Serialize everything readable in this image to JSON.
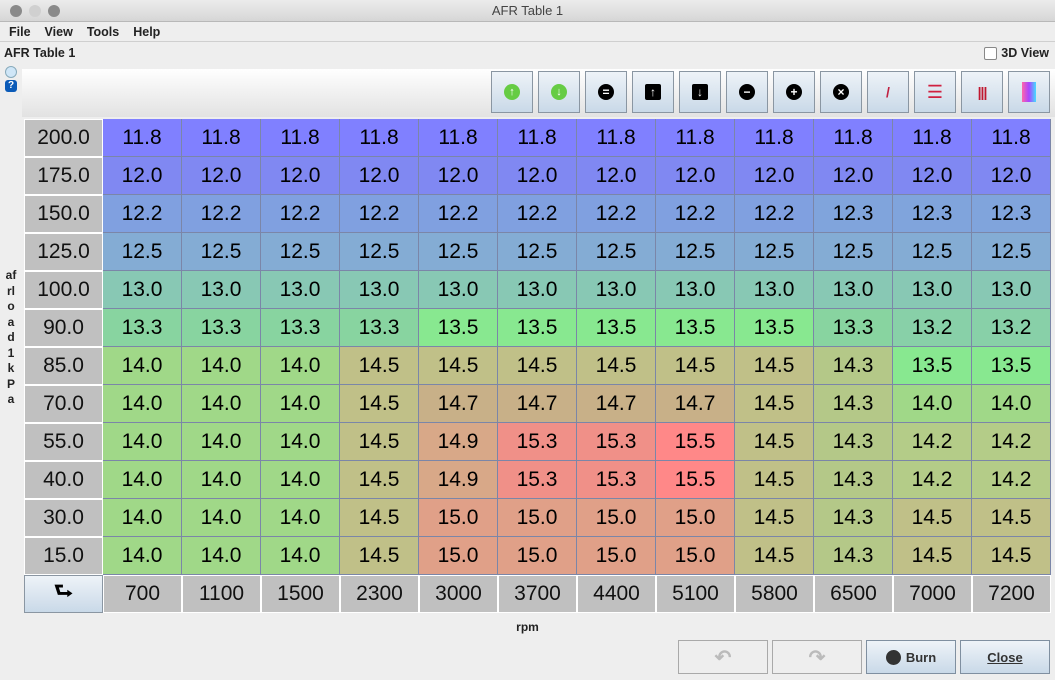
{
  "window": {
    "title": "AFR Table 1"
  },
  "menu": [
    {
      "label": "File"
    },
    {
      "label": "View"
    },
    {
      "label": "Tools"
    },
    {
      "label": "Help"
    }
  ],
  "heading": "AFR Table 1",
  "view3d_label": "3D View",
  "view3d_checked": false,
  "toolbar": [
    {
      "name": "increment-button",
      "icon": "green-up-circle",
      "glyph": "↑",
      "style": "g"
    },
    {
      "name": "decrement-button",
      "icon": "green-down-circle",
      "glyph": "↓",
      "style": "g"
    },
    {
      "name": "set-equal-button",
      "icon": "equals-circle",
      "glyph": "=",
      "style": "c"
    },
    {
      "name": "shift-up-button",
      "icon": "arrow-up-square",
      "glyph": "↑",
      "style": "sq"
    },
    {
      "name": "shift-down-button",
      "icon": "arrow-down-square",
      "glyph": "↓",
      "style": "sq"
    },
    {
      "name": "subtract-button",
      "icon": "minus-circle",
      "glyph": "−",
      "style": "c"
    },
    {
      "name": "add-button",
      "icon": "plus-circle",
      "glyph": "+",
      "style": "c"
    },
    {
      "name": "multiply-button",
      "icon": "x-circle",
      "glyph": "×",
      "style": "c"
    },
    {
      "name": "interpolate-button",
      "icon": "pencil-line",
      "glyph": "/",
      "style": "p"
    },
    {
      "name": "interpolate-horizontal-button",
      "icon": "horizontal-bars",
      "glyph": "☰",
      "style": "h"
    },
    {
      "name": "interpolate-vertical-button",
      "icon": "vertical-bars",
      "glyph": "|||",
      "style": "v"
    },
    {
      "name": "smooth-button",
      "icon": "gradient",
      "glyph": "▮",
      "style": "s"
    }
  ],
  "y_axis": {
    "label": "afrload1 kPa",
    "values": [
      "200.0",
      "175.0",
      "150.0",
      "125.0",
      "100.0",
      "90.0",
      "85.0",
      "70.0",
      "55.0",
      "40.0",
      "30.0",
      "15.0"
    ]
  },
  "x_axis": {
    "label": "rpm",
    "values": [
      "700",
      "1100",
      "1500",
      "2300",
      "3000",
      "3700",
      "4400",
      "5100",
      "5800",
      "6500",
      "7000",
      "7200"
    ]
  },
  "table": [
    [
      "11.8",
      "11.8",
      "11.8",
      "11.8",
      "11.8",
      "11.8",
      "11.8",
      "11.8",
      "11.8",
      "11.8",
      "11.8",
      "11.8"
    ],
    [
      "12.0",
      "12.0",
      "12.0",
      "12.0",
      "12.0",
      "12.0",
      "12.0",
      "12.0",
      "12.0",
      "12.0",
      "12.0",
      "12.0"
    ],
    [
      "12.2",
      "12.2",
      "12.2",
      "12.2",
      "12.2",
      "12.2",
      "12.2",
      "12.2",
      "12.2",
      "12.3",
      "12.3",
      "12.3"
    ],
    [
      "12.5",
      "12.5",
      "12.5",
      "12.5",
      "12.5",
      "12.5",
      "12.5",
      "12.5",
      "12.5",
      "12.5",
      "12.5",
      "12.5"
    ],
    [
      "13.0",
      "13.0",
      "13.0",
      "13.0",
      "13.0",
      "13.0",
      "13.0",
      "13.0",
      "13.0",
      "13.0",
      "13.0",
      "13.0"
    ],
    [
      "13.3",
      "13.3",
      "13.3",
      "13.3",
      "13.5",
      "13.5",
      "13.5",
      "13.5",
      "13.5",
      "13.3",
      "13.2",
      "13.2"
    ],
    [
      "14.0",
      "14.0",
      "14.0",
      "14.5",
      "14.5",
      "14.5",
      "14.5",
      "14.5",
      "14.5",
      "14.3",
      "13.5",
      "13.5"
    ],
    [
      "14.0",
      "14.0",
      "14.0",
      "14.5",
      "14.7",
      "14.7",
      "14.7",
      "14.7",
      "14.5",
      "14.3",
      "14.0",
      "14.0"
    ],
    [
      "14.0",
      "14.0",
      "14.0",
      "14.5",
      "14.9",
      "15.3",
      "15.3",
      "15.5",
      "14.5",
      "14.3",
      "14.2",
      "14.2"
    ],
    [
      "14.0",
      "14.0",
      "14.0",
      "14.5",
      "14.9",
      "15.3",
      "15.3",
      "15.5",
      "14.5",
      "14.3",
      "14.2",
      "14.2"
    ],
    [
      "14.0",
      "14.0",
      "14.0",
      "14.5",
      "15.0",
      "15.0",
      "15.0",
      "15.0",
      "14.5",
      "14.3",
      "14.5",
      "14.5"
    ],
    [
      "14.0",
      "14.0",
      "14.0",
      "14.5",
      "15.0",
      "15.0",
      "15.0",
      "15.0",
      "14.5",
      "14.3",
      "14.5",
      "14.5"
    ]
  ],
  "cell_colors": {
    "11.8": "#8080ff",
    "12.0": "#8088f2",
    "12.2": "#80a0e0",
    "12.3": "#80a4dc",
    "12.5": "#84acd4",
    "13.0": "#88c8b4",
    "13.2": "#88d0a8",
    "13.3": "#88d4a0",
    "13.5": "#88e890",
    "14.0": "#a0d888",
    "14.2": "#b4cc88",
    "14.3": "#b4c888",
    "14.5": "#c0c088",
    "14.7": "#c8b088",
    "14.9": "#d8a888",
    "15.0": "#e0a088",
    "15.3": "#f09088",
    "15.5": "#ff8888"
  },
  "buttons": {
    "undo": "undo",
    "redo": "redo",
    "burn": "Burn",
    "close": "Close"
  }
}
